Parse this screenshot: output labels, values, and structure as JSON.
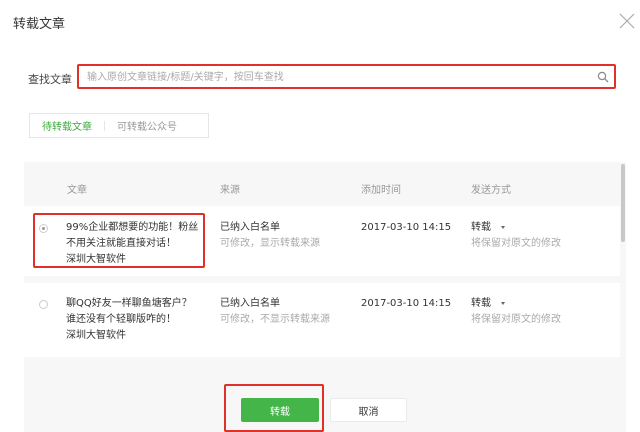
{
  "dialog": {
    "title": "转载文章"
  },
  "search": {
    "label": "查找文章",
    "placeholder": "输入原创文章链接/标题/关键字，按回车查找"
  },
  "tabs": [
    {
      "label": "待转载文章",
      "active": true
    },
    {
      "label": "可转载公众号",
      "active": false
    }
  ],
  "table": {
    "headers": [
      "文章",
      "来源",
      "添加时间",
      "发送方式"
    ],
    "rows": [
      {
        "selected": true,
        "title_line1": "99%企业都想要的功能！粉丝",
        "title_line2": "不用关注就能直接对话！",
        "author": "深圳大智软件",
        "source": "已纳入白名单",
        "source_note": "可修改，显示转载来源",
        "time": "2017-03-10 14:15",
        "method": "转载",
        "method_note": "将保留对原文的修改"
      },
      {
        "selected": false,
        "title_line1": "聊QQ好友一样聊鱼塘客户？",
        "title_line2": "谁还没有个轻聊版咋的！",
        "author": "深圳大智软件",
        "source": "已纳入白名单",
        "source_note": "可修改，不显示转载来源",
        "time": "2017-03-10 14:15",
        "method": "转载",
        "method_note": "将保留对原文的修改"
      }
    ]
  },
  "footer": {
    "confirm": "转载",
    "cancel": "取消"
  },
  "colors": {
    "accent": "#44b549",
    "highlight": "#e0302a"
  }
}
